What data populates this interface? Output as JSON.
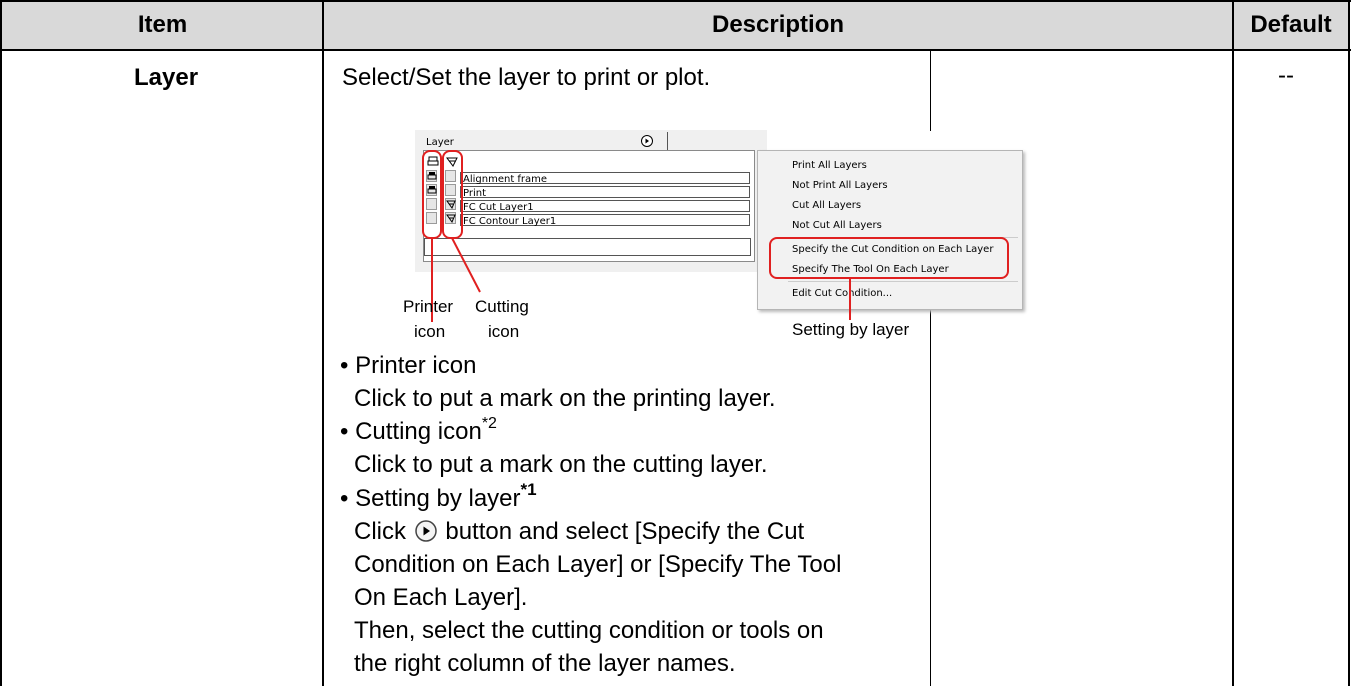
{
  "headers": {
    "item": "Item",
    "description": "Description",
    "default": "Default"
  },
  "row": {
    "item": "Layer",
    "default": "--",
    "summary": "Select/Set the layer to print or plot."
  },
  "panel": {
    "title": "Layer",
    "layers": [
      "Alignment frame",
      "Print",
      "FC Cut Layer1",
      "FC Contour Layer1"
    ],
    "menu": [
      "Print All Layers",
      "Not Print All Layers",
      "Cut All Layers",
      "Not Cut All Layers",
      "Specify the Cut Condition on Each Layer",
      "Specify The Tool On Each Layer",
      "Edit Cut Condition..."
    ],
    "callouts": {
      "printer_1": "Printer",
      "printer_2": "icon",
      "cutting_1": "Cutting",
      "cutting_2": "icon",
      "setting": "Setting by layer"
    }
  },
  "bullets": [
    {
      "title": "Printer icon",
      "sup": "",
      "lines": [
        "Click to put a mark on the printing layer."
      ]
    },
    {
      "title": "Cutting icon",
      "sup": "*2",
      "lines": [
        "Click to put a mark on the cutting layer."
      ]
    },
    {
      "title": "Setting by layer",
      "sup": "*1",
      "lines_pre": "Click",
      "lines_post": " button and select [Specify the Cut",
      "lines": [
        "Condition on Each Layer] or [Specify The Tool",
        "On Each Layer].",
        "Then, select the cutting condition or tools on",
        "the right column of the layer names."
      ]
    }
  ],
  "bullet_mark": "•"
}
